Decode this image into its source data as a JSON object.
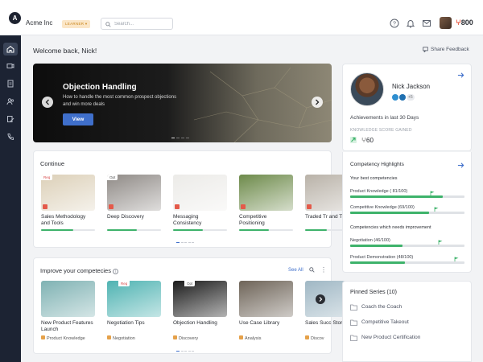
{
  "header": {
    "logo_letter": "A",
    "company": "Acme Inc",
    "role_badge": "LEARNER",
    "search_placeholder": "Search...",
    "points_symbol": "ⵖ",
    "points_value": "800",
    "icons": [
      "help-icon",
      "bell-icon",
      "mail-icon"
    ]
  },
  "sidebar": {
    "items": [
      {
        "icon": "home-icon",
        "active": true
      },
      {
        "icon": "video-icon",
        "active": false
      },
      {
        "icon": "document-icon",
        "active": false
      },
      {
        "icon": "people-icon",
        "active": false
      },
      {
        "icon": "edit-icon",
        "active": false
      },
      {
        "icon": "phone-icon",
        "active": false
      }
    ]
  },
  "welcome": "Welcome back, Nick!",
  "share_feedback": "Share Feedback",
  "hero": {
    "title": "Objection Handling",
    "subtitle": "How to handle the most common prospect objections and win more deals",
    "button": "View"
  },
  "continue": {
    "title": "Continue",
    "items": [
      {
        "title": "Sales Methodology and Tools",
        "tag": "Req",
        "progress": 0.6,
        "thumb": "#dcd0b8",
        "mark": "#e45a4a"
      },
      {
        "title": "Deep Discovery",
        "tag": "Opt",
        "progress": 0.55,
        "thumb": "#8f8a86",
        "mark": "#e45a4a"
      },
      {
        "title": "Messaging Consistency",
        "tag": "",
        "progress": 0.55,
        "thumb": "#ecebe8",
        "mark": "#e45a4a"
      },
      {
        "title": "Competitive Positioning",
        "tag": "",
        "progress": 0.55,
        "thumb": "#6d8a4a",
        "mark": "#e45a4a"
      },
      {
        "title": "Traded Tr and Train",
        "tag": "",
        "progress": 0.4,
        "thumb": "#b9b2a8",
        "mark": "#e45a4a"
      }
    ]
  },
  "improve": {
    "title": "Improve your competecies",
    "see_all": "See All",
    "items": [
      {
        "title": "New Product Features Launch",
        "tag": "",
        "category": "Product Knowledge",
        "thumb": "#7fb2b3"
      },
      {
        "title": "Negotiation Tips",
        "tag": "Req",
        "category": "Negotiation",
        "thumb": "#4fb3b2"
      },
      {
        "title": "Objection Handling",
        "tag": "Opt",
        "category": "Discovery",
        "thumb": "#1b1b1b"
      },
      {
        "title": "Use Case Library",
        "tag": "",
        "category": "Analysis",
        "thumb": "#6e6458"
      },
      {
        "title": "Sales Succ Stories",
        "tag": "",
        "category": "Discov",
        "thumb": "#9fb7c4"
      }
    ]
  },
  "profile": {
    "name": "Nick Jackson",
    "badge_count": "+5",
    "achievements": "Achievements in last 30 Days",
    "score_label": "KNOWLEDGE SCORE GAINED",
    "score_symbol": "ⵖ",
    "score_value": "60"
  },
  "competency": {
    "title": "Competency Highlights",
    "best_label": "Your best competencies",
    "improve_label": "Competencies which needs improvement",
    "best": [
      {
        "label": "Product Knowledge ( 81/100)",
        "value": 81,
        "target": 70
      },
      {
        "label": "Competitive Knowledge (69/100)",
        "value": 69,
        "target": 73
      }
    ],
    "needs": [
      {
        "label": "Negotiation (46/100)",
        "value": 46,
        "target": 77
      },
      {
        "label": "Product Demonstration (48/100)",
        "value": 48,
        "target": 91
      }
    ]
  },
  "pinned": {
    "title": "Pinned Series (10)",
    "items": [
      "Coach the Coach",
      "Competitive Takeout",
      "New Product Certification"
    ]
  },
  "colors": {
    "accent": "#3f6fcb",
    "progress": "#3eb36b",
    "sidebar": "#1c2333",
    "points": "#e8523a"
  }
}
